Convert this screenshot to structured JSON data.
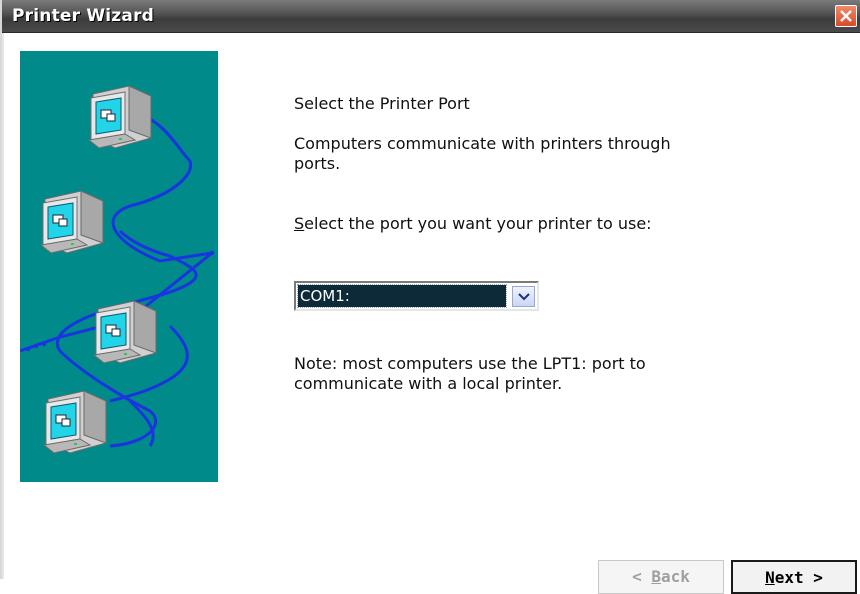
{
  "window": {
    "title": "Printer Wizard"
  },
  "heading": "Select the Printer Port",
  "intro": "Computers communicate with printers through ports.",
  "select_prompt": {
    "accel": "S",
    "rest": "elect the port you want your printer to use:"
  },
  "port_select": {
    "value": "COM1:"
  },
  "note": "Note: most computers use the LPT1: port to communicate with a local printer.",
  "buttons": {
    "back": {
      "prefix": "< ",
      "accel": "B",
      "rest": "ack"
    },
    "next": {
      "accel": "N",
      "rest": "ext >"
    }
  },
  "colors": {
    "art_background": "#008a8a",
    "network_line": "#1a35e0",
    "close_button": "#e06040"
  },
  "icons": {
    "close": "close-icon",
    "dropdown": "chevron-down-icon",
    "art": "network-computers-illustration"
  }
}
